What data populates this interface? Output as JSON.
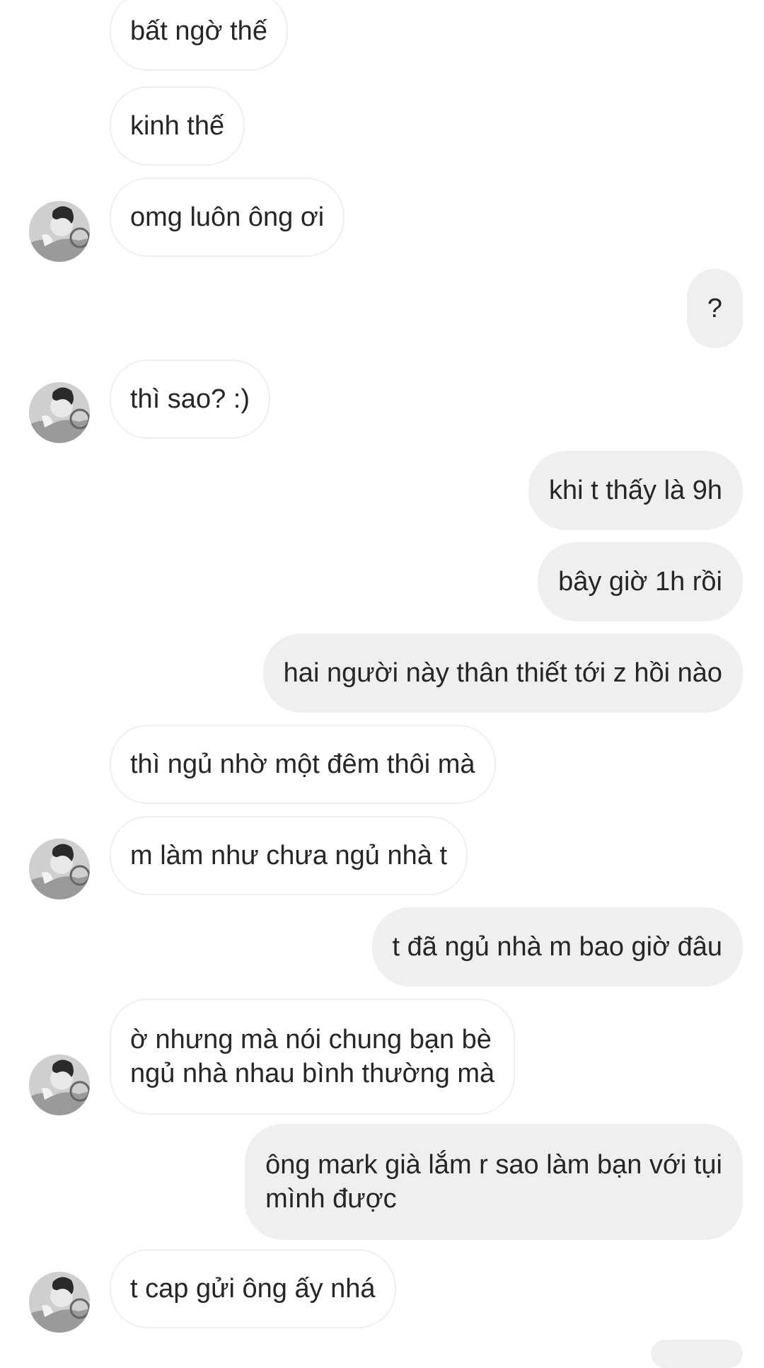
{
  "chat": {
    "messages": [
      {
        "sender": "other",
        "text": "bất ngờ thế"
      },
      {
        "sender": "other",
        "text": "kinh thế"
      },
      {
        "sender": "other",
        "text": "omg luôn ông ơi"
      },
      {
        "sender": "me",
        "text": "?"
      },
      {
        "sender": "other",
        "text": "thì sao? :)"
      },
      {
        "sender": "me",
        "text": "khi t thấy là 9h"
      },
      {
        "sender": "me",
        "text": "bây giờ 1h rồi"
      },
      {
        "sender": "me",
        "text": "hai người này thân thiết tới z hồi nào"
      },
      {
        "sender": "other",
        "text": "thì ngủ nhờ một đêm thôi mà"
      },
      {
        "sender": "other",
        "text": "m làm như chưa ngủ nhà t"
      },
      {
        "sender": "me",
        "text": "t đã ngủ nhà m bao giờ đâu"
      },
      {
        "sender": "other",
        "lines": [
          "ờ nhưng mà nói chung bạn bè",
          "ngủ nhà nhau bình thường mà"
        ]
      },
      {
        "sender": "me",
        "lines": [
          "ông mark già lắm r sao làm bạn với tụi",
          "mình được"
        ]
      },
      {
        "sender": "other",
        "text": "t cap gửi ông ấy nhá"
      }
    ]
  },
  "colors": {
    "incoming_bubble_bg": "#ffffff",
    "incoming_bubble_border": "#efefef",
    "outgoing_bubble_bg": "#efefef",
    "text": "#262626"
  },
  "icons": {
    "avatar": "avatar-photo"
  }
}
